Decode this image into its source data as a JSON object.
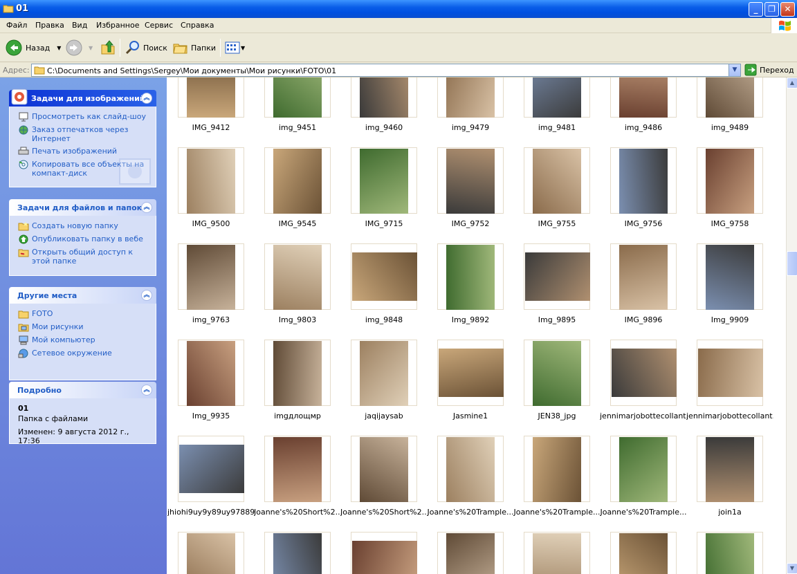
{
  "window": {
    "title": "01"
  },
  "menu": [
    "Файл",
    "Правка",
    "Вид",
    "Избранное",
    "Сервис",
    "Справка"
  ],
  "toolbar": {
    "back": "Назад",
    "search": "Поиск",
    "folders": "Папки"
  },
  "address": {
    "label": "Адрес:",
    "path": "C:\\Documents and Settings\\Sergey\\Мои документы\\Мои рисунки\\FOTO\\01",
    "go": "Переход"
  },
  "panels": {
    "image_tasks": {
      "title": "Задачи для изображений",
      "items": [
        "Просмотреть как слайд-шоу",
        "Заказ отпечатков через Интернет",
        "Печать изображений",
        "Копировать все объекты на компакт-диск"
      ]
    },
    "file_tasks": {
      "title": "Задачи для файлов и папок",
      "items": [
        "Создать новую папку",
        "Опубликовать папку в вебе",
        "Открыть общий доступ к этой папке"
      ]
    },
    "other_places": {
      "title": "Другие места",
      "items": [
        "FOTO",
        "Мои рисунки",
        "Мой компьютер",
        "Сетевое окружение"
      ]
    },
    "details": {
      "title": "Подробно",
      "name": "01",
      "type": "Папка с файлами",
      "modified": "Изменен: 9 августа 2012 г., 17:36"
    }
  },
  "files": [
    "IMG_9412",
    "img_9451",
    "img_9460",
    "img_9479",
    "img_9481",
    "img_9486",
    "img_9489",
    "IMG_9500",
    "IMG_9545",
    "IMG_9715",
    "IMG_9752",
    "IMG_9755",
    "IMG_9756",
    "IMG_9758",
    "img_9763",
    "Img_9803",
    "img_9848",
    "Img_9892",
    "Img_9895",
    "IMG_9896",
    "Img_9909",
    "Img_9935",
    "imgдлощмр",
    "jaqijaysab",
    "Jasmine1",
    "JEN38_jpg",
    "jennimarjobottecollant...",
    "jennimarjobottecollant...",
    "jhiohi9uy9y89uy97889...",
    "Joanne's%20Short%2...",
    "Joanne's%20Short%2...",
    "Joanne's%20Trample...",
    "Joanne's%20Trample...",
    "Joanne's%20Trample...",
    "join1a",
    "",
    "",
    "",
    "",
    "",
    "",
    ""
  ],
  "colors": {
    "title_blue": "#0a5ee8",
    "pane_blue": "#6f8fe0",
    "link_blue": "#215dc6"
  }
}
